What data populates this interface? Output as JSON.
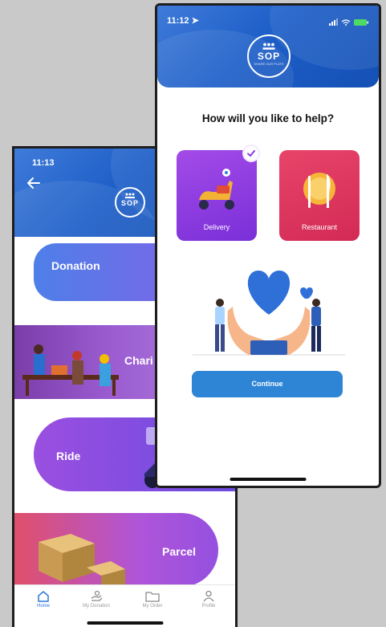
{
  "back_screen": {
    "status_time": "11:13",
    "back_icon": "arrow-left-icon",
    "logo": {
      "text": "SOP",
      "tagline": "SHARE OUR PLATE"
    },
    "cards": [
      {
        "label": "Donation"
      },
      {
        "label": "Chari"
      },
      {
        "label": "Ride"
      },
      {
        "label": "Parcel"
      }
    ],
    "tabs": [
      {
        "label": "Home",
        "icon": "home-icon",
        "active": true
      },
      {
        "label": "My Donation",
        "icon": "donation-hand-icon",
        "active": false
      },
      {
        "label": "My Order",
        "icon": "folder-icon",
        "active": false
      },
      {
        "label": "Profile",
        "icon": "user-icon",
        "active": false
      }
    ]
  },
  "front_screen": {
    "status_time": "11:12",
    "logo": {
      "text": "SOP",
      "tagline": "SHARE OUR PLATE"
    },
    "question": "How will you like to help?",
    "options": [
      {
        "label": "Delivery",
        "selected": true,
        "color": "#8b36e0"
      },
      {
        "label": "Restaurant",
        "selected": false,
        "color": "#e0355e"
      }
    ],
    "continue_label": "Continue"
  },
  "colors": {
    "header_blue": "#1e5fc8",
    "button_blue": "#2e84d5",
    "active_tab": "#2e78d6",
    "check_purple": "#8b36e0"
  }
}
